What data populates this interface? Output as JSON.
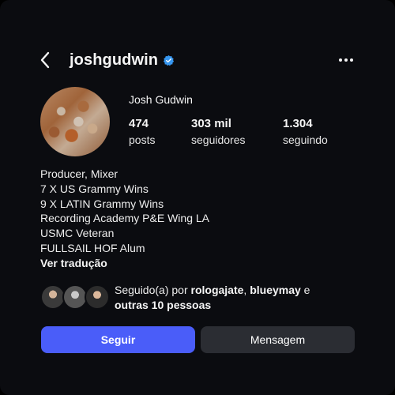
{
  "header": {
    "username": "joshgudwin",
    "back_icon": "chevron-left-icon",
    "verified_icon": "verified-badge-icon",
    "more_icon": "more-horizontal-icon",
    "verified_color": "#3797f0"
  },
  "profile": {
    "display_name": "Josh Gudwin",
    "stats": {
      "posts": {
        "value": "474",
        "label": "posts"
      },
      "followers": {
        "value": "303 mil",
        "label": "seguidores"
      },
      "following": {
        "value": "1.304",
        "label": "seguindo"
      }
    },
    "bio": [
      "Producer, Mixer",
      "7 X US Grammy Wins",
      "9 X LATIN Grammy Wins",
      "Recording Academy P&E Wing LA",
      "USMC Veteran",
      "FULLSAIL HOF Alum"
    ],
    "translate_label": "Ver tradução"
  },
  "followed_by": {
    "prefix": "Seguido(a) por ",
    "user1": "rologajate",
    "separator": ", ",
    "user2": "blueymay",
    "conjunction": " e",
    "others": "outras 10 pessoas"
  },
  "actions": {
    "follow_label": "Seguir",
    "message_label": "Mensagem",
    "follow_color": "#4a5df9",
    "message_color": "#2b2d33"
  }
}
